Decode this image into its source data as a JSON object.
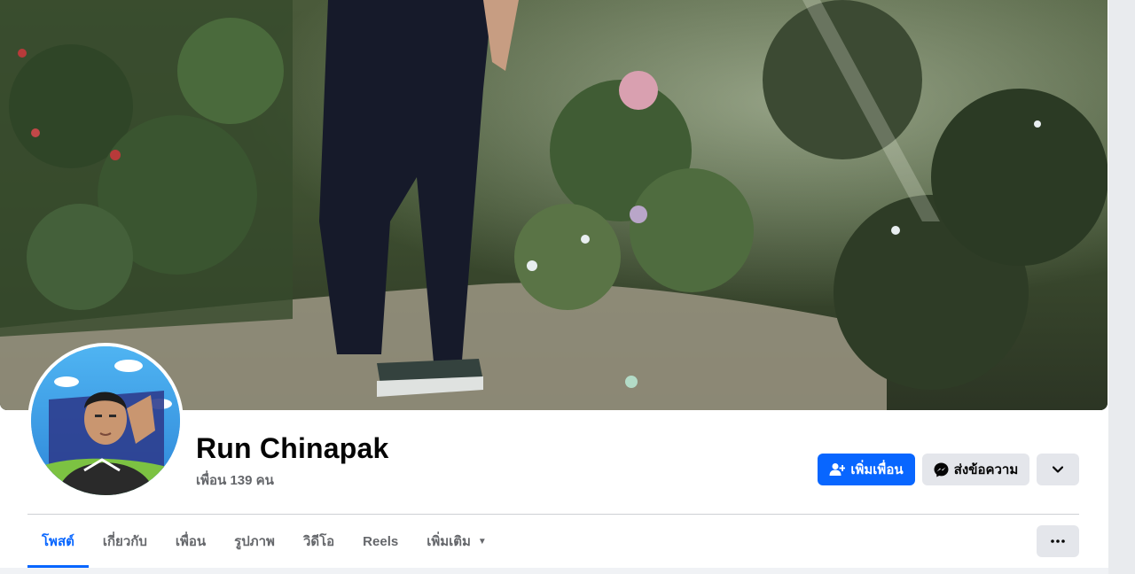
{
  "profile": {
    "name": "Run Chinapak",
    "friends_count": "เพื่อน 139 คน"
  },
  "actions": {
    "add_friend": "เพิ่มเพื่อน",
    "send_message": "ส่งข้อความ"
  },
  "tabs": [
    {
      "label": "โพสต์",
      "active": true
    },
    {
      "label": "เกี่ยวกับ",
      "active": false
    },
    {
      "label": "เพื่อน",
      "active": false
    },
    {
      "label": "รูปภาพ",
      "active": false
    },
    {
      "label": "วิดีโอ",
      "active": false
    },
    {
      "label": "Reels",
      "active": false
    },
    {
      "label": "เพิ่มเติม",
      "active": false
    }
  ],
  "colors": {
    "accent": "#0866ff",
    "secondary_button": "#e4e6eb",
    "text_primary": "#050505",
    "text_secondary": "#65676b"
  },
  "icons": [
    "user-plus-icon",
    "messenger-icon",
    "chevron-down-icon",
    "caret-down-icon",
    "more-horizontal-icon"
  ]
}
